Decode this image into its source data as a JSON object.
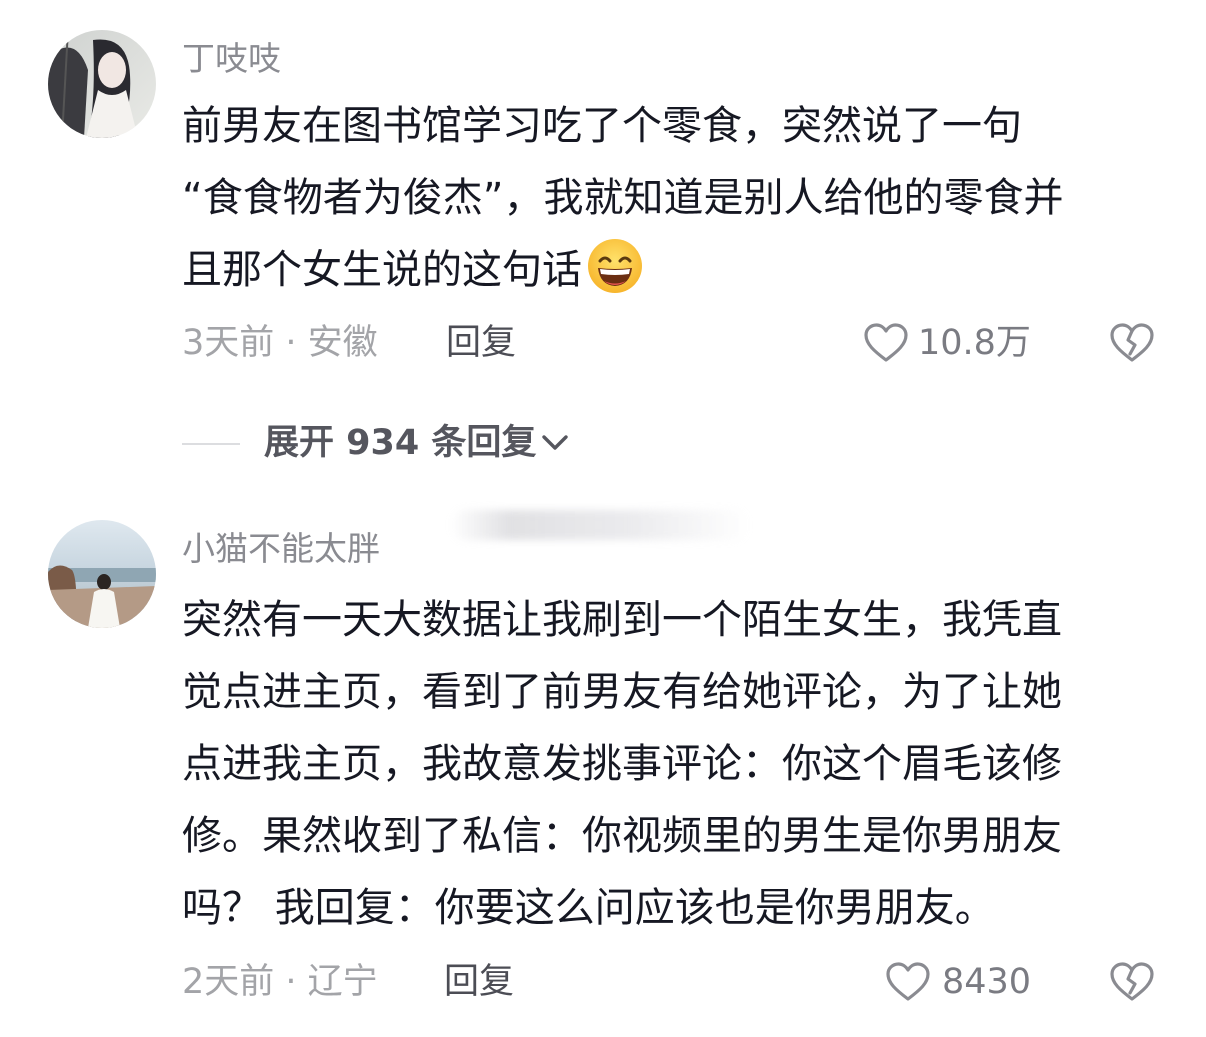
{
  "comments": [
    {
      "username": "丁吱吱",
      "text_lines": [
        "前男友在图书馆学习吃了个零食，突然说了一句",
        "“食食物者为俊杰”，我就知道是别人给他的零食并",
        "且那个女生说的这句话"
      ],
      "emoji": "grinning-sweat-emoji",
      "time_location": "3天前 · 安徽",
      "reply_label": "回复",
      "like_count": "10.8万"
    },
    {
      "username": "小猫不能太胖",
      "text_lines": [
        "突然有一天大数据让我刷到一个陌生女生，我凭直",
        "觉点进主页，看到了前男友有给她评论，为了让她",
        "点进我主页，我故意发挑事评论：你这个眉毛该修",
        "修。果然收到了私信：你视频里的男生是你男朋友",
        "吗？ 我回复：你要这么问应该也是你男朋友。"
      ],
      "time_location": "2天前 · 辽宁",
      "reply_label": "回复",
      "like_count": "8430"
    }
  ],
  "expand_replies": {
    "label": "展开 934 条回复"
  },
  "icons": {
    "like": "heart-outline-icon",
    "dislike": "broken-heart-icon",
    "expand": "chevron-down-icon"
  },
  "colors": {
    "text": "#161823",
    "username": "#8a8b91",
    "meta": "#a3a4a8",
    "reply": "#4c4d55"
  }
}
